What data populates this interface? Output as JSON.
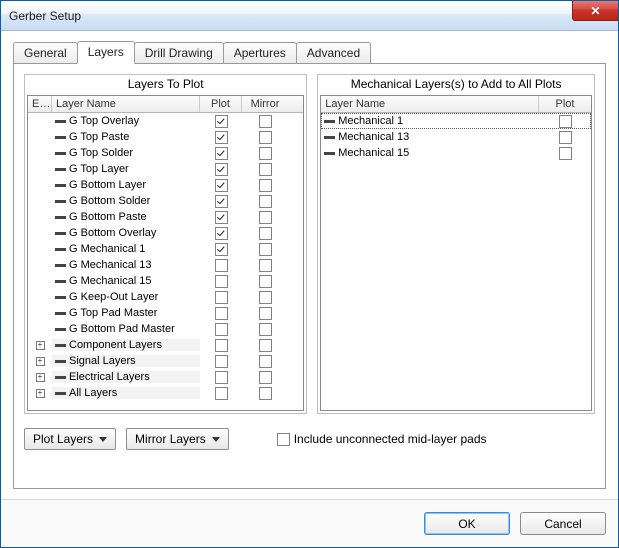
{
  "window": {
    "title": "Gerber Setup",
    "close_glyph": "✕"
  },
  "tabs": {
    "items": [
      {
        "label": "General",
        "active": false
      },
      {
        "label": "Layers",
        "active": true
      },
      {
        "label": "Drill Drawing",
        "active": false
      },
      {
        "label": "Apertures",
        "active": false
      },
      {
        "label": "Advanced",
        "active": false
      }
    ]
  },
  "left_panel": {
    "title": "Layers To Plot",
    "headers": {
      "ex": "Ex...",
      "name": "Layer Name",
      "plot": "Plot",
      "mirror": "Mirror"
    },
    "rows": [
      {
        "type": "layer",
        "name": "G Top Overlay",
        "plot": true,
        "mirror": false
      },
      {
        "type": "layer",
        "name": "G Top Paste",
        "plot": true,
        "mirror": false
      },
      {
        "type": "layer",
        "name": "G Top Solder",
        "plot": true,
        "mirror": false
      },
      {
        "type": "layer",
        "name": "G Top Layer",
        "plot": true,
        "mirror": false
      },
      {
        "type": "layer",
        "name": "G Bottom Layer",
        "plot": true,
        "mirror": false
      },
      {
        "type": "layer",
        "name": "G Bottom Solder",
        "plot": true,
        "mirror": false
      },
      {
        "type": "layer",
        "name": "G Bottom Paste",
        "plot": true,
        "mirror": false
      },
      {
        "type": "layer",
        "name": "G Bottom Overlay",
        "plot": true,
        "mirror": false
      },
      {
        "type": "layer",
        "name": "G Mechanical 1",
        "plot": true,
        "mirror": false
      },
      {
        "type": "layer",
        "name": "G Mechanical 13",
        "plot": false,
        "mirror": false
      },
      {
        "type": "layer",
        "name": "G Mechanical 15",
        "plot": false,
        "mirror": false
      },
      {
        "type": "layer",
        "name": "G Keep-Out Layer",
        "plot": false,
        "mirror": false
      },
      {
        "type": "layer",
        "name": "G Top Pad Master",
        "plot": false,
        "mirror": false
      },
      {
        "type": "layer",
        "name": "G Bottom Pad Master",
        "plot": false,
        "mirror": false
      },
      {
        "type": "group",
        "name": "Component Layers",
        "plot": false,
        "mirror": false
      },
      {
        "type": "group",
        "name": "Signal Layers",
        "plot": false,
        "mirror": false
      },
      {
        "type": "group",
        "name": "Electrical Layers",
        "plot": false,
        "mirror": false
      },
      {
        "type": "group",
        "name": "All Layers",
        "plot": false,
        "mirror": false
      }
    ]
  },
  "right_panel": {
    "title": "Mechanical Layers(s) to Add to All Plots",
    "headers": {
      "name": "Layer Name",
      "plot": "Plot"
    },
    "rows": [
      {
        "name": "Mechanical 1",
        "plot": false,
        "selected": true
      },
      {
        "name": "Mechanical 13",
        "plot": false,
        "selected": false
      },
      {
        "name": "Mechanical 15",
        "plot": false,
        "selected": false
      }
    ]
  },
  "controls": {
    "plot_layers_label": "Plot Layers",
    "mirror_layers_label": "Mirror Layers",
    "include_unconnected_label": "Include unconnected mid-layer pads",
    "include_unconnected_checked": false
  },
  "buttons": {
    "ok": "OK",
    "cancel": "Cancel"
  }
}
